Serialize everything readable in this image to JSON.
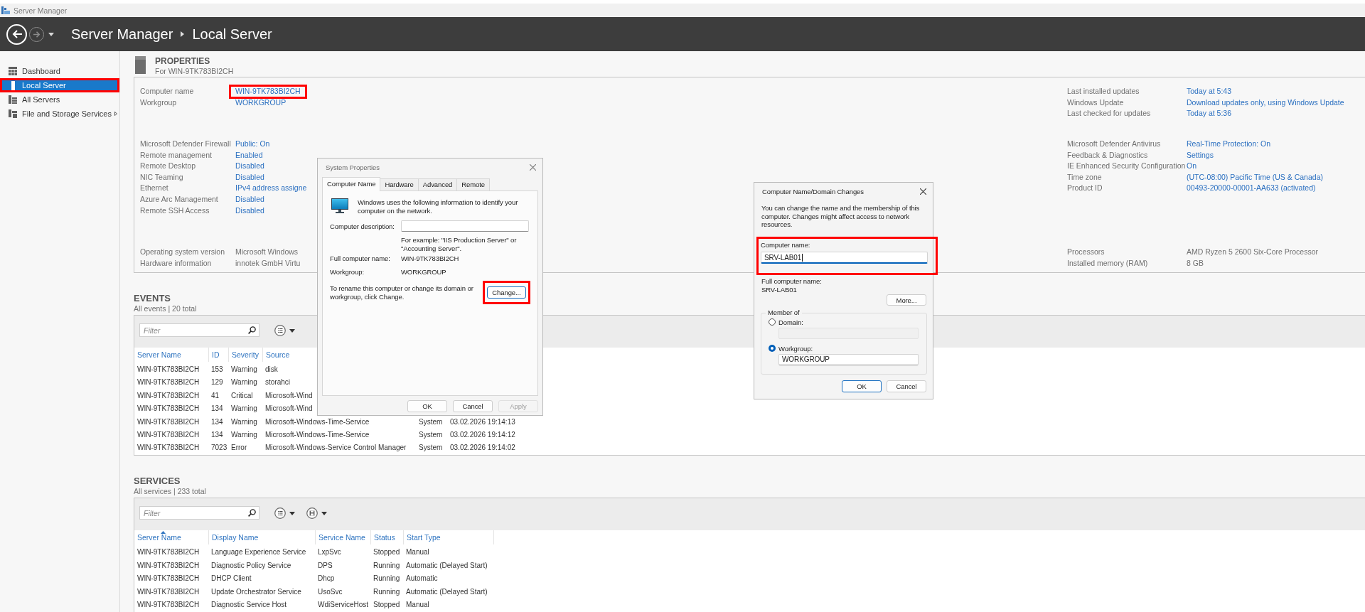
{
  "title_bar": {
    "title": "Server Manager"
  },
  "header": {
    "breadcrumb": [
      "Server Manager",
      "Local Server"
    ]
  },
  "sidebar": {
    "items": [
      {
        "label": "Dashboard",
        "selected": false,
        "highlighted": false,
        "expandable": false
      },
      {
        "label": "Local Server",
        "selected": true,
        "highlighted": true,
        "expandable": false
      },
      {
        "label": "All Servers",
        "selected": false,
        "highlighted": false,
        "expandable": false
      },
      {
        "label": "File and Storage Services",
        "selected": false,
        "highlighted": false,
        "expandable": true
      }
    ]
  },
  "properties": {
    "title": "PROPERTIES",
    "subtitle": "For WIN-9TK783BI2CH",
    "left_sections": [
      {
        "rows": [
          {
            "label": "Computer name",
            "value": "WIN-9TK783BI2CH",
            "kind": "link",
            "highlighted": true
          },
          {
            "label": "Workgroup",
            "value": "WORKGROUP",
            "kind": "link",
            "highlighted": false
          }
        ]
      },
      {
        "rows": [
          {
            "label": "Microsoft Defender Firewall",
            "value": "Public: On",
            "kind": "link",
            "highlighted": false
          },
          {
            "label": "Remote management",
            "value": "Enabled",
            "kind": "link",
            "highlighted": false
          },
          {
            "label": "Remote Desktop",
            "value": "Disabled",
            "kind": "link",
            "highlighted": false
          },
          {
            "label": "NIC Teaming",
            "value": "Disabled",
            "kind": "link",
            "highlighted": false
          },
          {
            "label": "Ethernet",
            "value": "IPv4 address assigne",
            "kind": "link",
            "highlighted": false
          },
          {
            "label": "Azure Arc Management",
            "value": "Disabled",
            "kind": "link",
            "highlighted": false
          },
          {
            "label": "Remote SSH Access",
            "value": "Disabled",
            "kind": "link",
            "highlighted": false
          }
        ]
      },
      {
        "rows": [
          {
            "label": "Operating system version",
            "value": "Microsoft Windows",
            "kind": "text",
            "highlighted": false
          },
          {
            "label": "Hardware information",
            "value": "innotek GmbH Virtu",
            "kind": "text",
            "highlighted": false
          }
        ]
      }
    ],
    "right_sections": [
      {
        "rows": [
          {
            "label": "Last installed updates",
            "value": "Today at 5:43",
            "kind": "link"
          },
          {
            "label": "Windows Update",
            "value": "Download updates only, using Windows Update",
            "kind": "link"
          },
          {
            "label": "Last checked for updates",
            "value": "Today at 5:36",
            "kind": "link"
          }
        ]
      },
      {
        "rows": [
          {
            "label": "Microsoft Defender Antivirus",
            "value": "Real-Time Protection: On",
            "kind": "link"
          },
          {
            "label": "Feedback & Diagnostics",
            "value": "Settings",
            "kind": "link"
          },
          {
            "label": "IE Enhanced Security Configuration",
            "value": "On",
            "kind": "link"
          },
          {
            "label": "Time zone",
            "value": "(UTC-08:00) Pacific Time (US & Canada)",
            "kind": "link"
          },
          {
            "label": "Product ID",
            "value": "00493-20000-00001-AA633 (activated)",
            "kind": "link"
          }
        ]
      },
      {
        "rows": [
          {
            "label": "Processors",
            "value": "AMD Ryzen 5 2600 Six-Core Processor",
            "kind": "text"
          },
          {
            "label": "Installed memory (RAM)",
            "value": "8 GB",
            "kind": "text"
          }
        ]
      }
    ]
  },
  "events": {
    "title": "EVENTS",
    "subtitle": "All events | 20 total",
    "filter": {
      "placeholder": "Filter"
    },
    "columns": [
      "Server Name",
      "ID",
      "Severity",
      "Source"
    ],
    "rows": [
      [
        "WIN-9TK783BI2CH",
        "153",
        "Warning",
        "disk"
      ],
      [
        "WIN-9TK783BI2CH",
        "129",
        "Warning",
        "storahci"
      ],
      [
        "WIN-9TK783BI2CH",
        "41",
        "Critical",
        "Microsoft-Wind"
      ],
      [
        "WIN-9TK783BI2CH",
        "134",
        "Warning",
        "Microsoft-Wind"
      ],
      [
        "WIN-9TK783BI2CH",
        "134",
        "Warning",
        "Microsoft-Windows-Time-Service",
        "System",
        "03.02.2026 19:14:13"
      ],
      [
        "WIN-9TK783BI2CH",
        "134",
        "Warning",
        "Microsoft-Windows-Time-Service",
        "System",
        "03.02.2026 19:14:12"
      ],
      [
        "WIN-9TK783BI2CH",
        "7023",
        "Error",
        "Microsoft-Windows-Service Control Manager",
        "System",
        "03.02.2026 19:14:02"
      ]
    ]
  },
  "services": {
    "title": "SERVICES",
    "subtitle": "All services | 233 total",
    "filter": {
      "placeholder": "Filter"
    },
    "columns": [
      {
        "label": "Server Name",
        "sorted": true
      },
      {
        "label": "Display Name",
        "sorted": false
      },
      {
        "label": "Service Name",
        "sorted": false
      },
      {
        "label": "Status",
        "sorted": false
      },
      {
        "label": "Start Type",
        "sorted": false
      }
    ],
    "rows": [
      [
        "WIN-9TK783BI2CH",
        "Language Experience Service",
        "LxpSvc",
        "Stopped",
        "Manual"
      ],
      [
        "WIN-9TK783BI2CH",
        "Diagnostic Policy Service",
        "DPS",
        "Running",
        "Automatic (Delayed Start)"
      ],
      [
        "WIN-9TK783BI2CH",
        "DHCP Client",
        "Dhcp",
        "Running",
        "Automatic"
      ],
      [
        "WIN-9TK783BI2CH",
        "Update Orchestrator Service",
        "UsoSvc",
        "Running",
        "Automatic (Delayed Start)"
      ],
      [
        "WIN-9TK783BI2CH",
        "Diagnostic Service Host",
        "WdiServiceHost",
        "Stopped",
        "Manual"
      ]
    ]
  },
  "system_properties": {
    "title": "System Properties",
    "tabs": [
      {
        "label": "Computer Name",
        "selected": true
      },
      {
        "label": "Hardware",
        "selected": false
      },
      {
        "label": "Advanced",
        "selected": false
      },
      {
        "label": "Remote",
        "selected": false
      }
    ],
    "intro": "Windows uses the following information to identify your computer on the network.",
    "description_label": "Computer description:",
    "example": "For example: \"IIS Production Server\" or \"Accounting Server\".",
    "full_name_label": "Full computer name:",
    "full_name": "WIN-9TK783BI2CH",
    "workgroup_label": "Workgroup:",
    "workgroup": "WORKGROUP",
    "rename_text": "To rename this computer or change its domain or workgroup, click Change.",
    "change_button": {
      "label": "Change...",
      "focused": true,
      "highlighted": true
    },
    "buttons": [
      {
        "label": "OK",
        "disabled": false
      },
      {
        "label": "Cancel",
        "disabled": false
      },
      {
        "label": "Apply",
        "disabled": true
      }
    ]
  },
  "name_dialog": {
    "title": "Computer Name/Domain Changes",
    "intro": "You can change the name and the membership of this computer. Changes might affect access to network resources.",
    "computer_name": {
      "label": "Computer name:",
      "value": "SRV-LAB01",
      "focused": true,
      "highlighted": true
    },
    "full_name_label": "Full computer name:",
    "full_name": "SRV-LAB01",
    "more_button": "More...",
    "member_of": {
      "legend": "Member of",
      "options": [
        {
          "label": "Domain:",
          "selected": false
        },
        {
          "label": "Workgroup:",
          "selected": true,
          "value": "WORKGROUP"
        }
      ]
    },
    "buttons": [
      {
        "label": "OK",
        "default": true
      },
      {
        "label": "Cancel",
        "default": false
      }
    ]
  }
}
